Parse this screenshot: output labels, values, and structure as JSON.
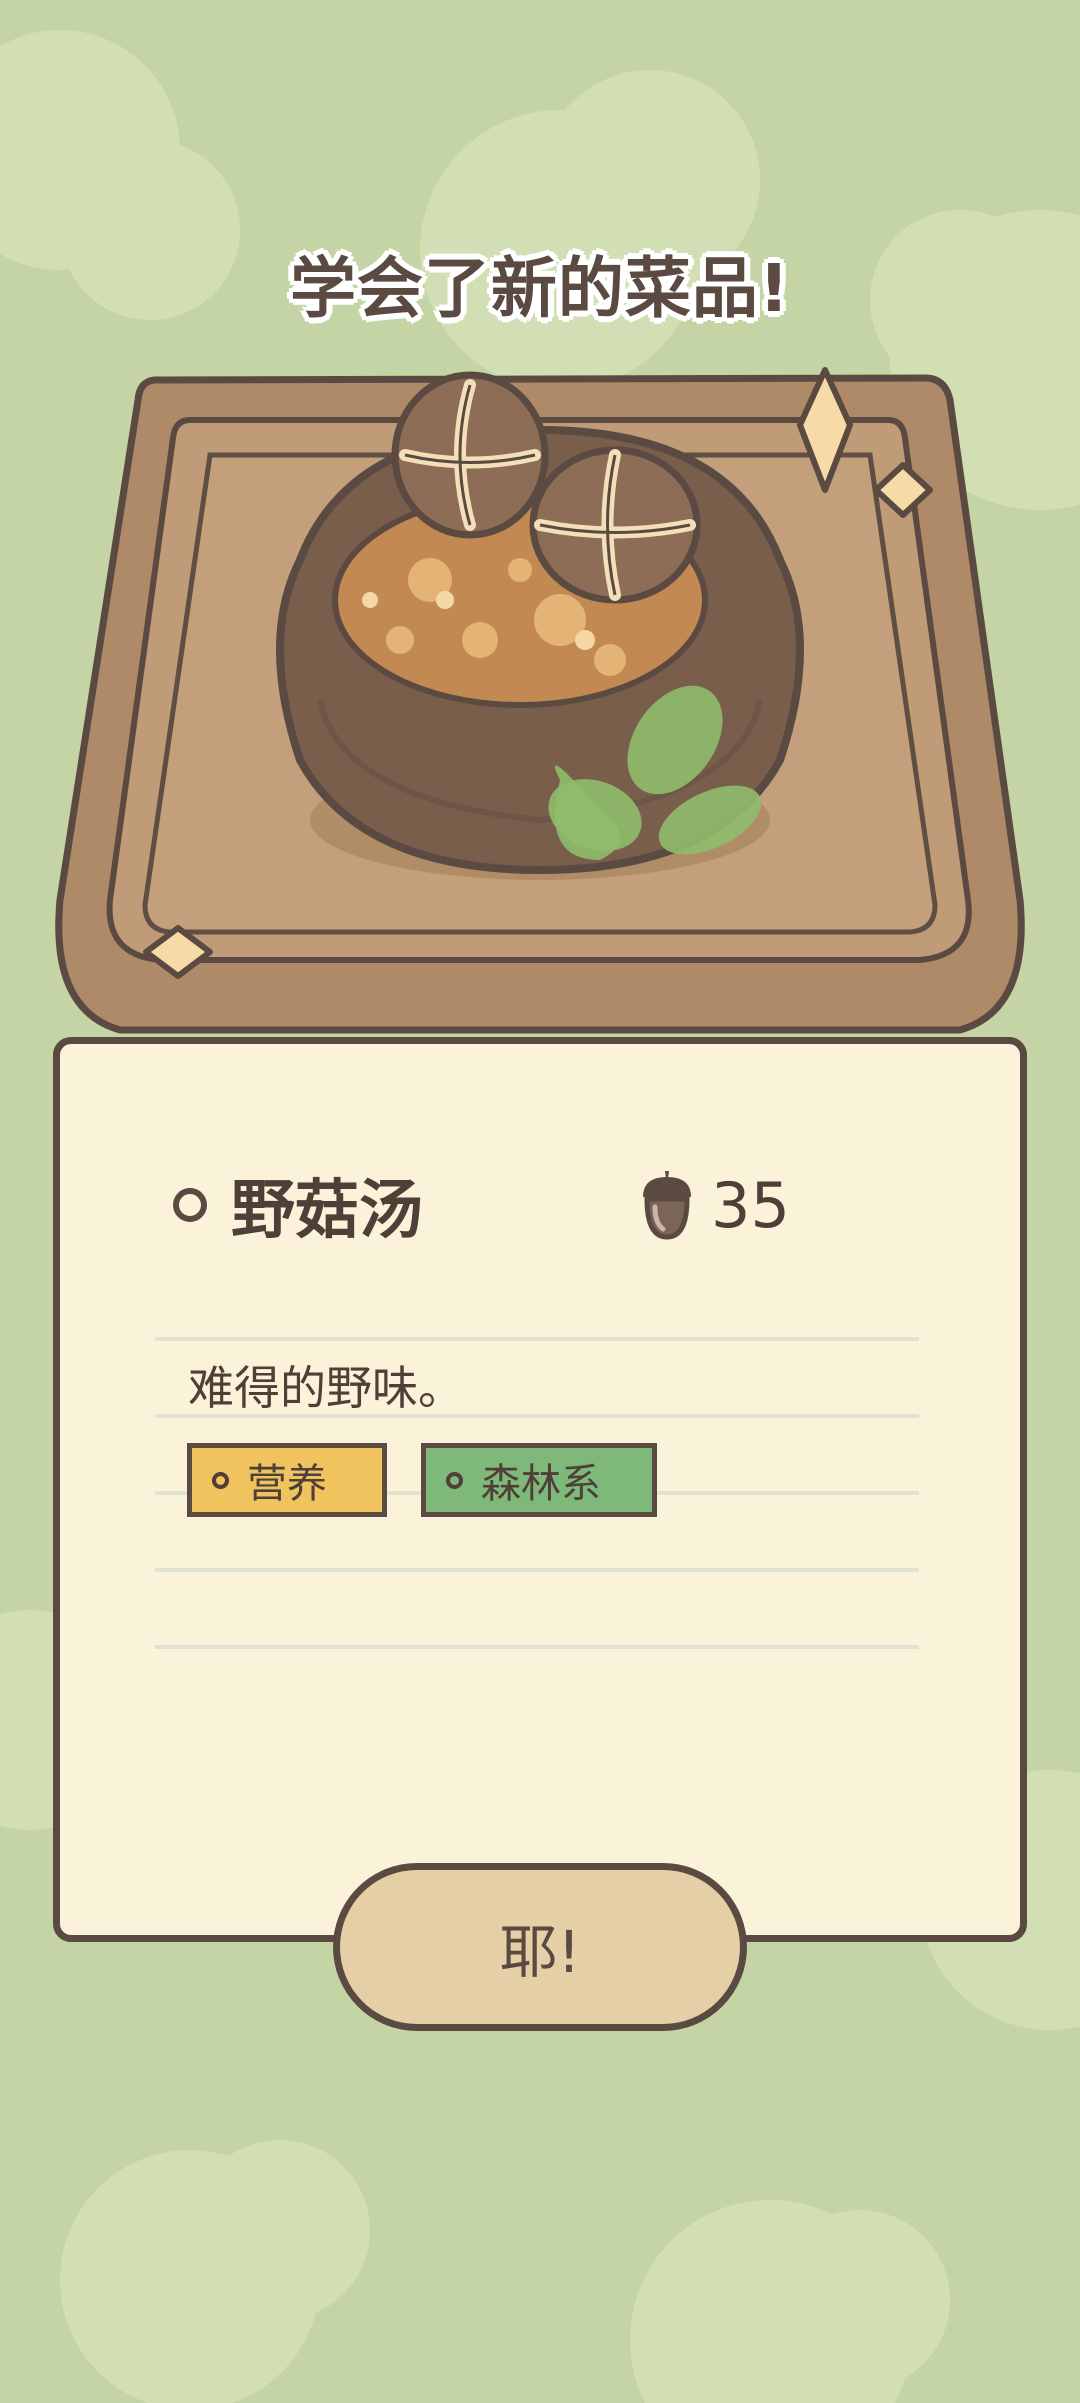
{
  "colors": {
    "background": "#c4d4a4",
    "card": "#fbf3d9",
    "outline": "#5a4a42",
    "tray": "#ae8a68",
    "button": "#e4cfa7",
    "tag_yellow": "#f0c35e",
    "tag_green": "#7fb97a"
  },
  "header": {
    "title": "学会了新的菜品!"
  },
  "dish": {
    "name": "野菇汤",
    "price": "35",
    "price_icon": "acorn-icon",
    "description": "难得的野味。",
    "tags": [
      {
        "label": "营养",
        "color": "#f0c35e"
      },
      {
        "label": "森林系",
        "color": "#7fb97a"
      }
    ]
  },
  "actions": {
    "confirm_label": "耶!"
  }
}
